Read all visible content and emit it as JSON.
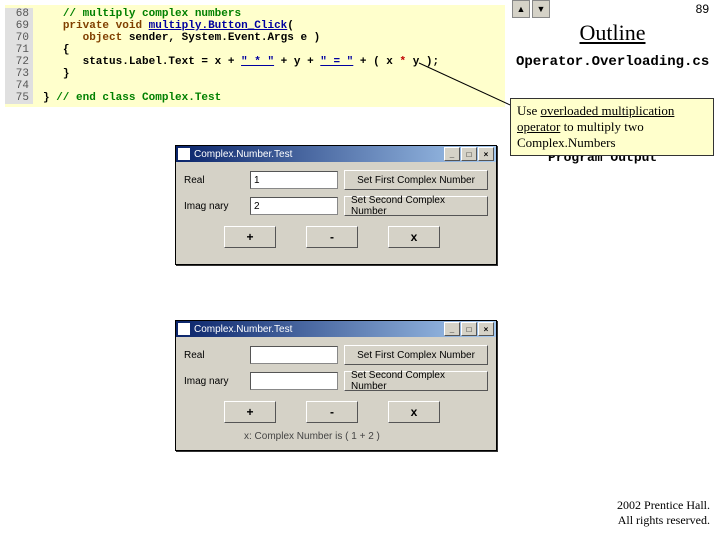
{
  "slide_number": "89",
  "outline": {
    "title": "Outline",
    "filename": "Operator.Overloading.cs",
    "program_output_label": "Program Output"
  },
  "code": {
    "lines": [
      {
        "n": "68",
        "pre": "   ",
        "seg": [
          {
            "cls": "green",
            "t": "// multiply complex numbers"
          }
        ]
      },
      {
        "n": "69",
        "pre": "   ",
        "seg": [
          {
            "cls": "brown",
            "t": "private"
          },
          {
            "cls": "",
            "t": " "
          },
          {
            "cls": "brown",
            "t": "void"
          },
          {
            "cls": "",
            "t": " "
          },
          {
            "cls": "blue",
            "t": "multiply.Button_Click"
          },
          {
            "cls": "",
            "t": "("
          }
        ]
      },
      {
        "n": "70",
        "pre": "      ",
        "seg": [
          {
            "cls": "brown",
            "t": "object"
          },
          {
            "cls": "",
            "t": " sender, System.Event.Args e )"
          }
        ]
      },
      {
        "n": "71",
        "pre": "   ",
        "seg": [
          {
            "cls": "",
            "t": "{"
          }
        ]
      },
      {
        "n": "72",
        "pre": "      ",
        "seg": [
          {
            "cls": "",
            "t": "status.Label.Text = x + "
          },
          {
            "cls": "blue",
            "t": "\" * \""
          },
          {
            "cls": "",
            "t": " + y + "
          },
          {
            "cls": "blue",
            "t": "\" = \""
          },
          {
            "cls": "",
            "t": " + ( x "
          },
          {
            "cls": "red",
            "t": "*"
          },
          {
            "cls": "",
            "t": " y );"
          }
        ]
      },
      {
        "n": "73",
        "pre": "   ",
        "seg": [
          {
            "cls": "",
            "t": "}"
          }
        ]
      },
      {
        "n": "74",
        "pre": "",
        "seg": []
      },
      {
        "n": "75",
        "pre": "",
        "seg": [
          {
            "cls": "",
            "t": "} "
          },
          {
            "cls": "green",
            "t": "// end class Complex.Test"
          }
        ]
      }
    ]
  },
  "callout": {
    "t1": "Use ",
    "u1": "overloaded multiplication operator",
    "t2": " to multiply two Complex.Numbers"
  },
  "dialogs": [
    {
      "title": "Complex.Number.Test",
      "real_label": "Real",
      "imag_label": "Imag nary",
      "real_value": "1",
      "imag_value": "2",
      "set1": "Set First Complex Number",
      "set2": "Set Second Complex Number",
      "ops": [
        "+",
        "-",
        "x"
      ],
      "status": ""
    },
    {
      "title": "Complex.Number.Test",
      "real_label": "Real",
      "imag_label": "Imag nary",
      "real_value": "",
      "imag_value": "",
      "set1": "Set First Complex Number",
      "set2": "Set Second Complex Number",
      "ops": [
        "+",
        "-",
        "x"
      ],
      "status": "x: Complex Number is ( 1 + 2 )"
    }
  ],
  "footer": {
    "l1": " 2002 Prentice Hall.",
    "l2": "All rights reserved."
  }
}
